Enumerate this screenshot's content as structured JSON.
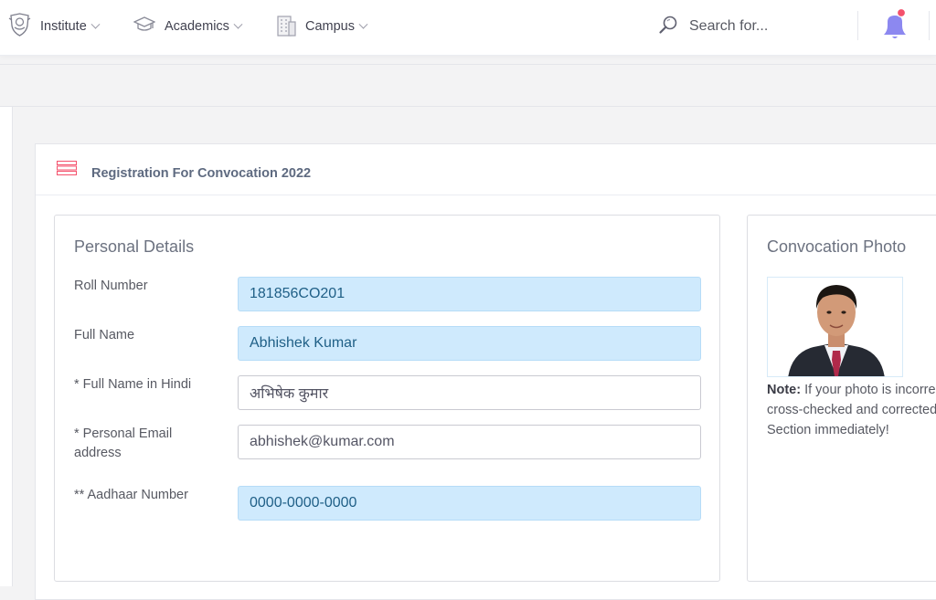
{
  "nav": {
    "items": [
      {
        "label": "Institute",
        "icon": "institute-emblem-icon"
      },
      {
        "label": "Academics",
        "icon": "graduation-cap-icon"
      },
      {
        "label": "Campus",
        "icon": "building-icon"
      }
    ],
    "search_placeholder": "Search for..."
  },
  "portlet": {
    "title": "Registration For Convocation 2022"
  },
  "personal": {
    "title": "Personal Details",
    "rows": [
      {
        "label": "Roll Number",
        "value": "181856CO201"
      },
      {
        "label": "Full Name",
        "value": "Abhishek Kumar"
      },
      {
        "label": "* Full Name in Hindi",
        "value": "अभिषेक कुमार"
      },
      {
        "label": "* Personal Email address",
        "value": "abhishek@kumar.com"
      },
      {
        "label": "** Aadhaar Number",
        "value": "0000-0000-0000"
      }
    ]
  },
  "photo": {
    "title": "Convocation Photo",
    "note_strong": "Note:",
    "note_line1": " If your photo is incorrec",
    "note_line2": "cross-checked and corrected",
    "note_line3": "Section immediately!"
  },
  "colors": {
    "readonly_field": "#cfeafd",
    "accent_red": "#f4516c",
    "bell": "#8c88f0"
  }
}
